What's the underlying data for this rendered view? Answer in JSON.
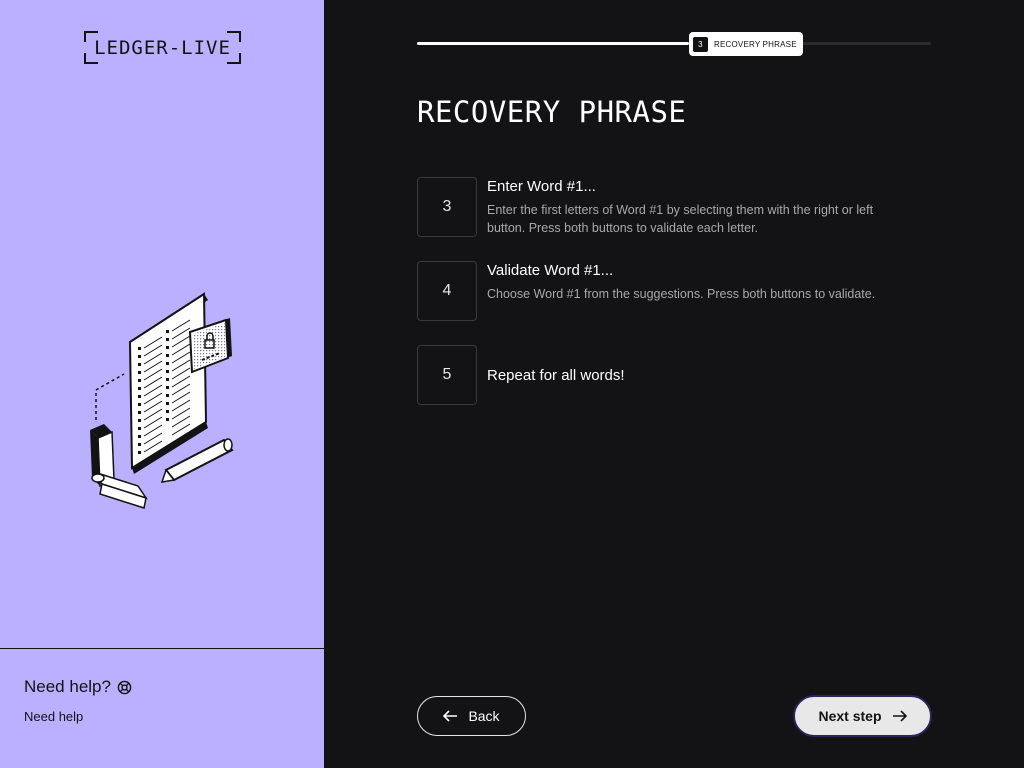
{
  "sidebar": {
    "logo_text": "LEDGER-LIVE",
    "help": {
      "title": "Need help?",
      "link": "Need help"
    }
  },
  "progress": {
    "fraction": 0.53,
    "step_number": "3",
    "step_label": "RECOVERY PHRASE"
  },
  "page": {
    "title": "RECOVERY PHRASE"
  },
  "steps": [
    {
      "number": "3",
      "title": "Enter Word #1...",
      "description": "Enter the first letters of Word #1 by selecting them with the right or left button. Press both buttons to validate each letter."
    },
    {
      "number": "4",
      "title": "Validate Word #1...",
      "description": "Choose Word #1 from the suggestions. Press both buttons to validate."
    },
    {
      "number": "5",
      "title": "Repeat for all words!"
    }
  ],
  "buttons": {
    "back": "Back",
    "next": "Next step"
  },
  "colors": {
    "sidebar_bg": "#bbb0ff",
    "main_bg": "#131214",
    "accent_border": "#2a2558"
  }
}
